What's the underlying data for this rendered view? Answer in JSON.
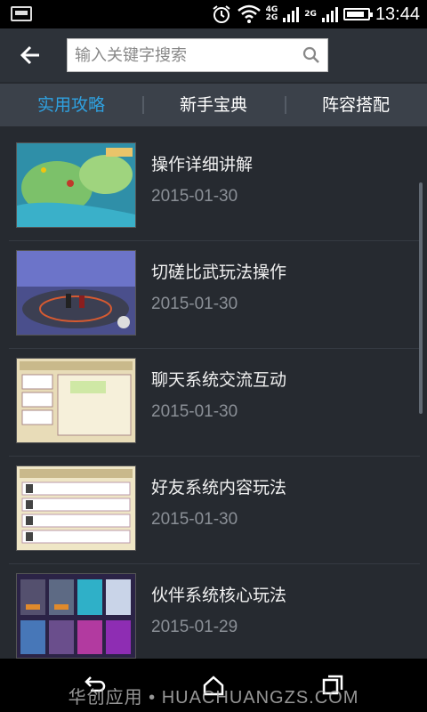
{
  "status_bar": {
    "time": "13:44",
    "network_top": "4G",
    "network_bottom": "2G",
    "network_second": "2G",
    "battery_level": 0.85
  },
  "header": {
    "back_icon": "back-arrow-icon",
    "search_placeholder": "输入关键字搜索",
    "search_icon": "search-icon"
  },
  "tabs": [
    {
      "label": "实用攻略",
      "active": true
    },
    {
      "label": "新手宝典",
      "active": false
    },
    {
      "label": "阵容搭配",
      "active": false
    }
  ],
  "articles": [
    {
      "title": "操作详细讲解",
      "date": "2015-01-30"
    },
    {
      "title": "切磋比武玩法操作",
      "date": "2015-01-30"
    },
    {
      "title": "聊天系统交流互动",
      "date": "2015-01-30"
    },
    {
      "title": "好友系统内容玩法",
      "date": "2015-01-30"
    },
    {
      "title": "伙伴系统核心玩法",
      "date": "2015-01-29"
    }
  ],
  "watermark": "华创应用 • HUACHUANGZS.COM",
  "colors": {
    "accent": "#2fa1e0",
    "background": "#262a30"
  }
}
